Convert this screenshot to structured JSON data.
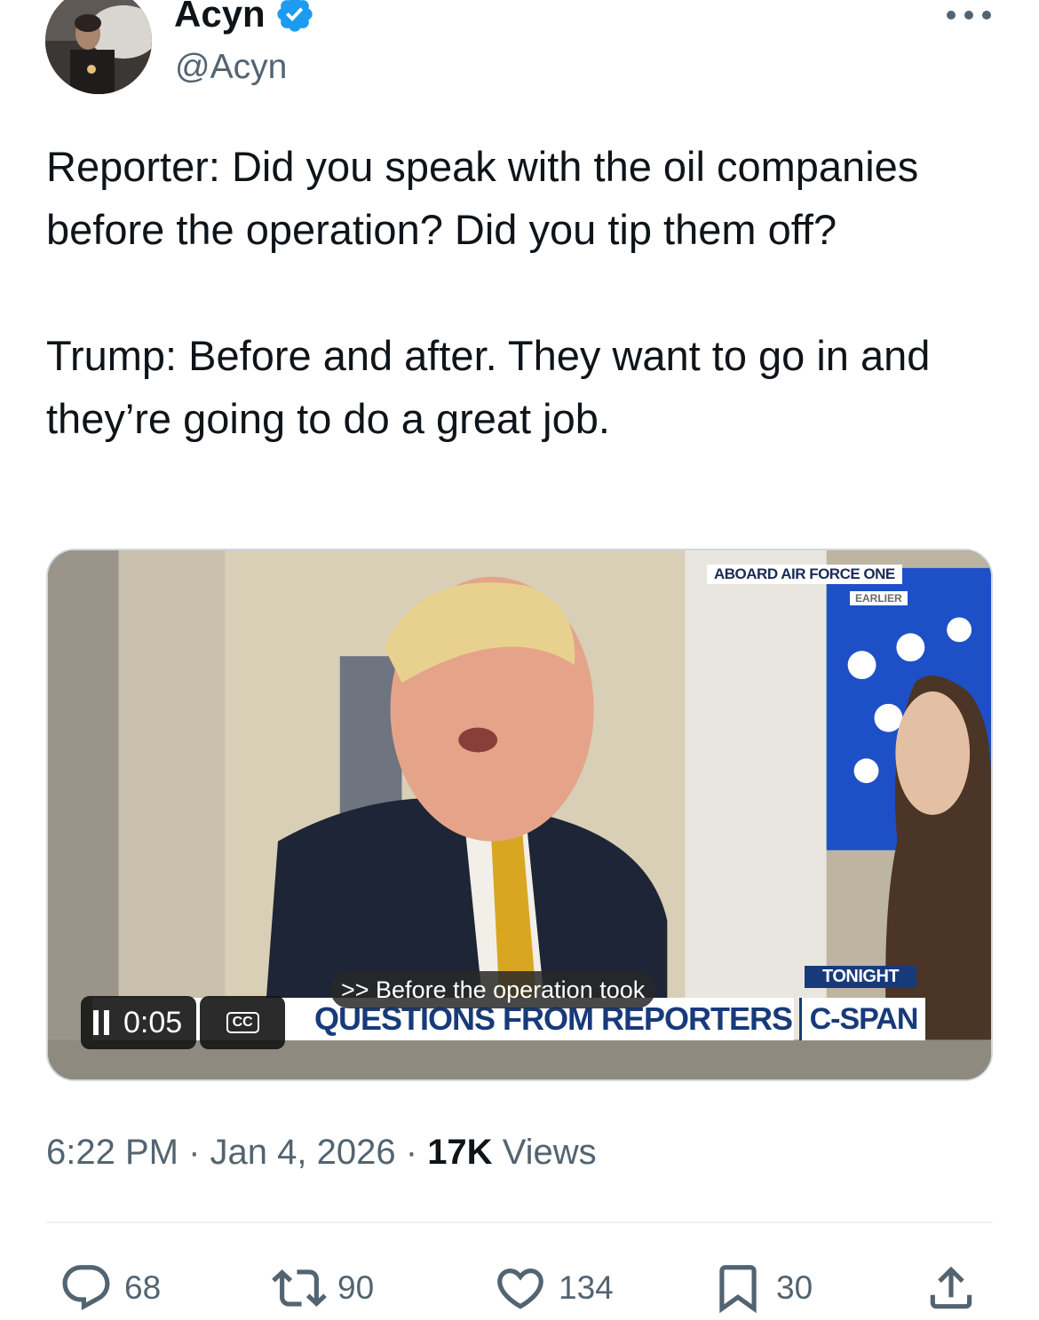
{
  "author": {
    "name": "Acyn",
    "handle": "@Acyn",
    "verified": true,
    "verified_color": "#1d9bf0"
  },
  "tweet": {
    "paragraphs": [
      "Reporter: Did you speak with the oil companies before the operation? Did you tip them off?",
      "Trump: Before and after. They want to go in and they’re going to do a great job."
    ]
  },
  "video": {
    "time": "0:05",
    "cc_label": "CC",
    "caption": ">> Before the operation took",
    "chyron_top": "ABOARD AIR FORCE ONE",
    "chyron_earlier": "EARLIER",
    "chyron_tonight": "TONIGHT",
    "chyron_main": "QUESTIONS FROM REPORTERS",
    "network": "C-SPAN"
  },
  "meta": {
    "time": "6:22 PM",
    "separator": "·",
    "date": "Jan 4, 2026",
    "views_count": "17K",
    "views_label": "Views"
  },
  "actions": {
    "replies": "68",
    "reposts": "90",
    "likes": "134",
    "bookmarks": "30"
  },
  "colors": {
    "text_primary": "#0f1419",
    "text_secondary": "#536471",
    "divider": "#eff3f4"
  },
  "icons": [
    "more-icon",
    "verified-badge-icon",
    "reply-icon",
    "repost-icon",
    "like-icon",
    "bookmark-icon",
    "share-icon",
    "pause-icon",
    "cc-icon"
  ]
}
